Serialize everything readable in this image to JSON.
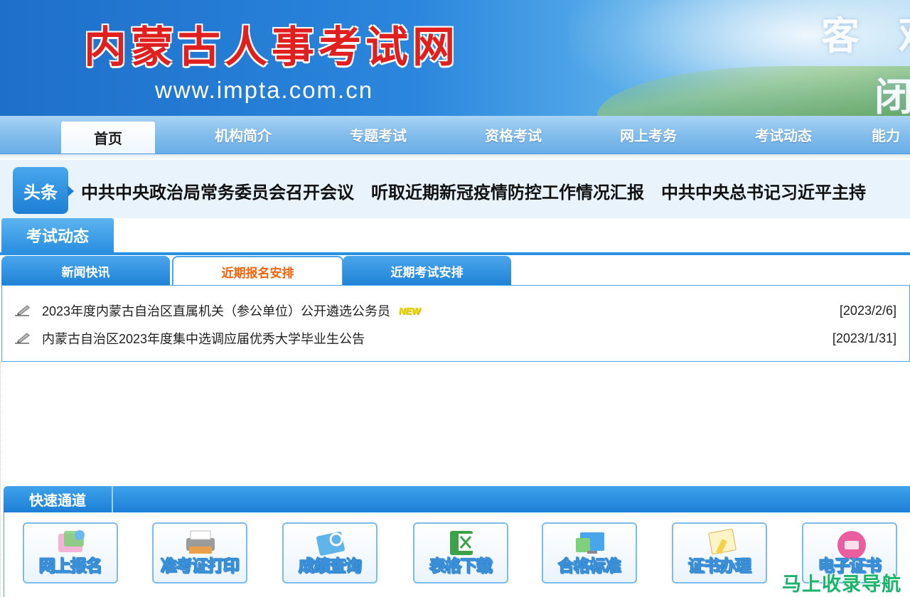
{
  "banner": {
    "site_title": "内蒙古人事考试网",
    "site_url": "www.impta.com.cn",
    "slogan_line1": "客 观",
    "slogan_line2": "闭"
  },
  "nav": {
    "items": [
      {
        "label": "首页",
        "active": true
      },
      {
        "label": "机构简介"
      },
      {
        "label": "专题考试"
      },
      {
        "label": "资格考试"
      },
      {
        "label": "网上考务"
      },
      {
        "label": "考试动态"
      },
      {
        "label": "能力"
      }
    ]
  },
  "headline": {
    "badge": "头条",
    "text": "中共中央政治局常务委员会召开会议　听取近期新冠疫情防控工作情况汇报　中共中央总书记习近平主持"
  },
  "exam_news": {
    "section_title": "考试动态",
    "tabs": [
      {
        "label": "新闻快讯"
      },
      {
        "label": "近期报名安排",
        "active": true
      },
      {
        "label": "近期考试安排"
      }
    ],
    "items": [
      {
        "title": "2023年度内蒙古自治区直属机关（参公单位）公开遴选公务员",
        "badge": "NEW",
        "date": "[2023/2/6]"
      },
      {
        "title": "内蒙古自治区2023年度集中选调应届优秀大学毕业生公告",
        "date": "[2023/1/31]"
      }
    ]
  },
  "quick_channel": {
    "title": "快速通道",
    "tiles": [
      {
        "label": "网上报名",
        "icon": "online-registration-icon"
      },
      {
        "label": "准考证打印",
        "icon": "printer-icon"
      },
      {
        "label": "成绩查询",
        "icon": "magnifier-icon"
      },
      {
        "label": "表格下载",
        "icon": "excel-icon"
      },
      {
        "label": "合格标准",
        "icon": "monitor-icon"
      },
      {
        "label": "证书办理",
        "icon": "certificate-icon"
      },
      {
        "label": "电子证书",
        "icon": "e-certificate-icon"
      }
    ]
  },
  "watermark": "马上收录导航",
  "colors": {
    "brand_blue": "#2a8fe0",
    "title_red": "#e0201e",
    "active_tab_orange": "#f2630b",
    "watermark_green": "#19b46a"
  }
}
